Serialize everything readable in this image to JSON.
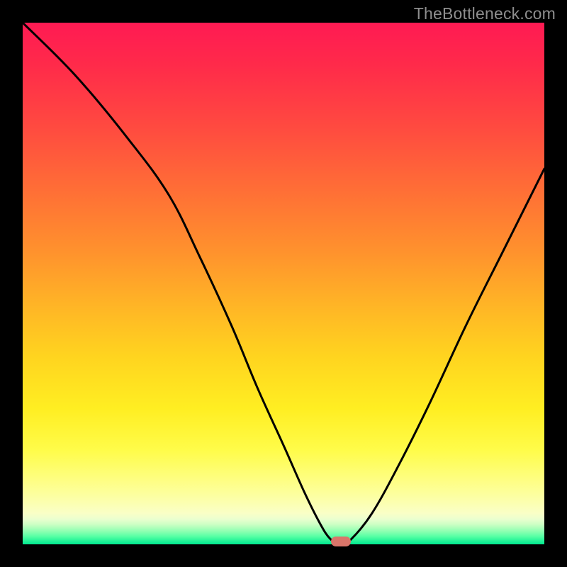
{
  "watermark": "TheBottleneck.com",
  "chart_data": {
    "type": "line",
    "title": "",
    "xlabel": "",
    "ylabel": "",
    "xlim": [
      0,
      100
    ],
    "ylim": [
      0,
      100
    ],
    "grid": false,
    "notch": {
      "x": 61,
      "y": 0
    },
    "series": [
      {
        "name": "bottleneck-curve",
        "x": [
          0,
          10,
          20,
          28,
          34,
          40,
          45,
          50,
          54,
          57,
          59,
          61,
          63,
          67,
          72,
          78,
          85,
          92,
          100
        ],
        "values": [
          100,
          90,
          78,
          67,
          55,
          42,
          30,
          19,
          10,
          4,
          1,
          0,
          1,
          6,
          15,
          27,
          42,
          56,
          72
        ]
      }
    ],
    "gradient_stops": [
      {
        "pct": 0,
        "color": "#ff1a53"
      },
      {
        "pct": 20,
        "color": "#ff4a40"
      },
      {
        "pct": 44,
        "color": "#ff922d"
      },
      {
        "pct": 64,
        "color": "#ffd41f"
      },
      {
        "pct": 82,
        "color": "#fffc4a"
      },
      {
        "pct": 94,
        "color": "#faffc6"
      },
      {
        "pct": 100,
        "color": "#00e88f"
      }
    ]
  }
}
